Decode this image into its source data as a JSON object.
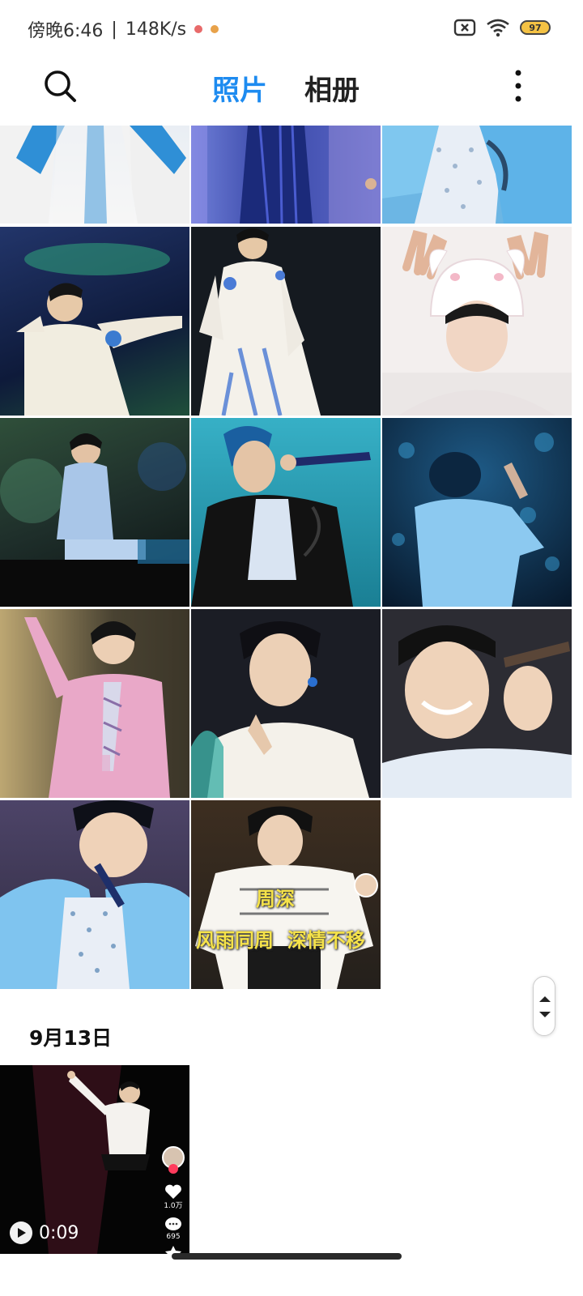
{
  "status_bar": {
    "time": "傍晚6:46",
    "separator": "|",
    "network_speed": "148K/s",
    "battery_level": "97",
    "icons": [
      "sim-off-icon",
      "wifi-icon",
      "battery-icon"
    ]
  },
  "header": {
    "search_icon": "search-icon",
    "tabs": [
      {
        "label": "照片",
        "active": true
      },
      {
        "label": "相册",
        "active": false
      }
    ],
    "more_icon": "more-vertical-icon",
    "accent_color": "#1d8bf0"
  },
  "grid": {
    "photos": [
      {
        "subject": "white jacket blue tie",
        "bg": "#cfe3f5"
      },
      {
        "subject": "stage blue curtains",
        "bg": "#4a5ab8"
      },
      {
        "subject": "blue sleeves sequins",
        "bg": "#8fc6ea"
      },
      {
        "subject": "singer blue stage",
        "bg": "#1a2f5a"
      },
      {
        "subject": "white costume stage",
        "bg": "#111a24"
      },
      {
        "subject": "bunny hat peace sign",
        "bg": "#efeaea"
      },
      {
        "subject": "sitting on stage",
        "bg": "#24402b"
      },
      {
        "subject": "black jacket microphone",
        "bg": "#2ea2b5"
      },
      {
        "subject": "blue lights back view",
        "bg": "#0b2a44"
      },
      {
        "subject": "pink jacket waving",
        "bg": "#c9b98a"
      },
      {
        "subject": "white shirt thinking",
        "bg": "#1d1d26"
      },
      {
        "subject": "smiling with microphone",
        "bg": "#3a3a40"
      },
      {
        "subject": "blue puffy jacket",
        "bg": "#3d3550"
      },
      {
        "subject": "white jacket text overlay",
        "bg": "#3a2e22"
      }
    ],
    "overlay": {
      "line1": "周深",
      "line2": "风雨同周  深情不移"
    }
  },
  "section": {
    "date_label": "9月13日"
  },
  "video": {
    "duration": "0:09",
    "likes": "1.0万",
    "comments": "695"
  }
}
